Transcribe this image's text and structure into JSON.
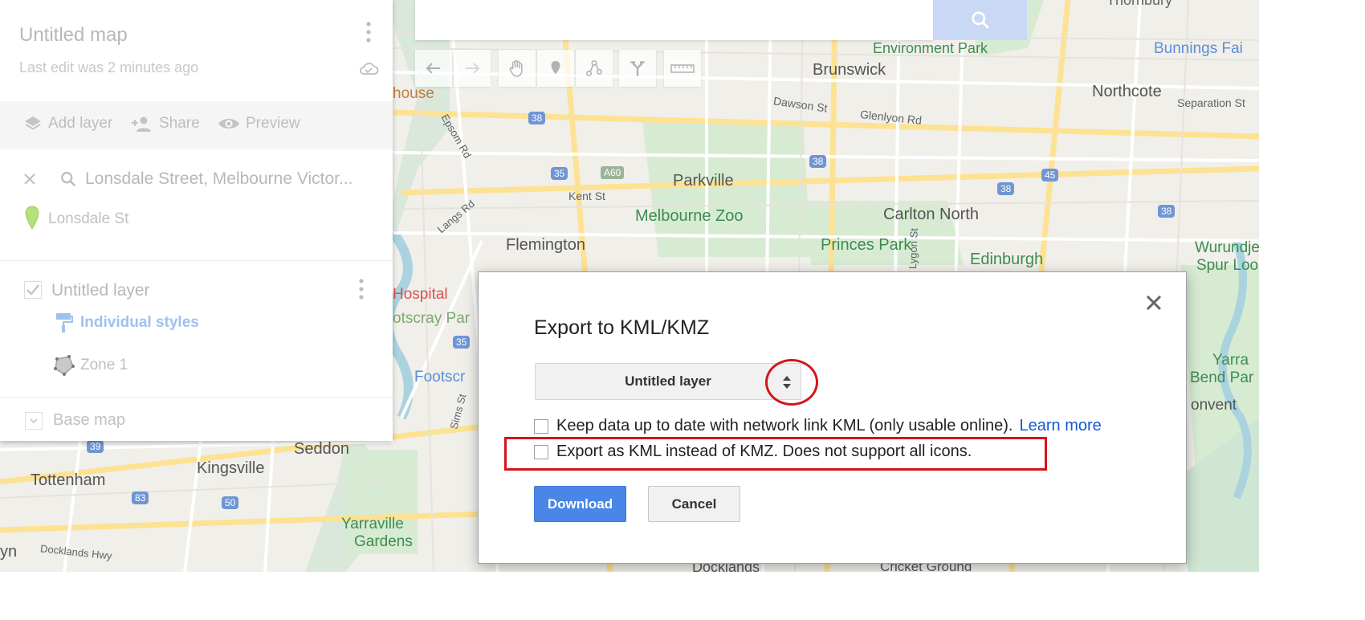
{
  "map_title": "Untitled map",
  "last_edit": "Last edit was 2 minutes ago",
  "toolbar": {
    "add_layer": "Add layer",
    "share": "Share",
    "preview": "Preview"
  },
  "search_result": {
    "query": "Lonsdale Street, Melbourne Victor...",
    "place": "Lonsdale St"
  },
  "layer": {
    "name": "Untitled layer",
    "styles": "Individual styles",
    "feature": "Zone 1"
  },
  "base_map": "Base map",
  "map_labels": {
    "thornbury": "Thornbury",
    "brunswick": "Brunswick",
    "environment_park": "Environment Park",
    "bunnings": "Bunnings Fai",
    "northcote": "Northcote",
    "separation": "Separation St",
    "dawson": "Dawson St",
    "glenlyon": "Glenlyon Rd",
    "house": "house",
    "epsom": "Epsom Rd",
    "parkville": "Parkville",
    "kent": "Kent St",
    "langs": "Langs Rd",
    "melbourne_zoo": "Melbourne Zoo",
    "carlton_north": "Carlton North",
    "flemington": "Flemington",
    "princes_park": "Princes Park",
    "edinburgh": "Edinburgh",
    "wurundjeri": "Wurundjeri",
    "spur_lookout": "Spur Lookout",
    "hospital": "Hospital",
    "footscray_park": "otscray Par",
    "footscr": "Footscr",
    "yarra_bend": "Yarra",
    "bend_par": "Bend Par",
    "convent": "onvent",
    "seddon": "Seddon",
    "kingsville": "Kingsville",
    "tottenham": "Tottenham",
    "yarraville": "Yarraville",
    "gardens": "Gardens",
    "docklands_hwy": "Docklands Hwy",
    "yn": "yn",
    "sims": "Sims St",
    "dockland": "Docklands",
    "cricket": "Cricket Ground",
    "lygon": "Lygon St",
    "r38a": "38",
    "r38b": "38",
    "r38c": "38",
    "r38d": "38",
    "r38e": "38",
    "r35a": "35",
    "r35b": "35",
    "a60": "A60",
    "r45": "45",
    "r39": "39",
    "r83": "83",
    "r50": "50"
  },
  "dialog": {
    "title": "Export to KML/KMZ",
    "select_value": "Untitled layer",
    "network_link_label": "Keep data up to date with network link KML (only usable online).",
    "learn_more": "Learn more",
    "export_kml_label": "Export as KML instead of KMZ. Does not support all icons.",
    "download": "Download",
    "cancel": "Cancel"
  },
  "colors": {
    "primary_button": "#4a86e8",
    "annotation_red": "#d6141c",
    "map_bg": "#f2efe9",
    "link": "#1558d6"
  }
}
